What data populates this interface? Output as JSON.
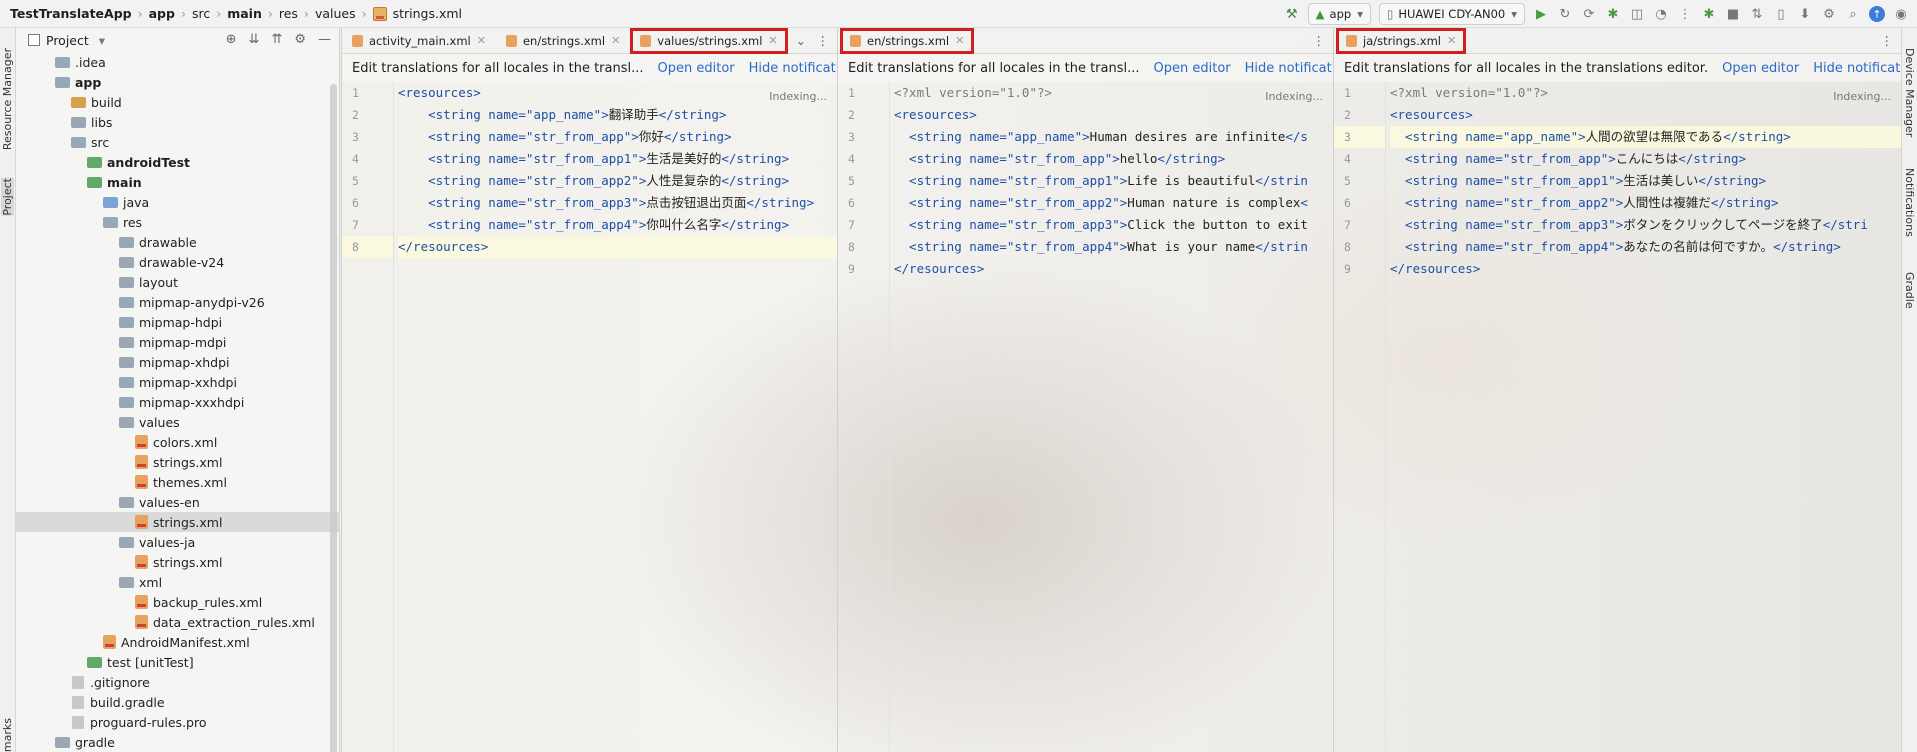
{
  "topbar": {
    "crumbs": [
      "TestTranslateApp",
      "app",
      "src",
      "main",
      "res",
      "values"
    ],
    "file": "strings.xml",
    "run_config": "app",
    "device": "HUAWEI CDY-AN00"
  },
  "strips": {
    "left1": "Resource Manager",
    "left2": "Project",
    "left3": "Bookmarks",
    "right1": "Device Manager",
    "right2": "Notifications",
    "right3": "Gradle"
  },
  "project": {
    "title": "Project",
    "tree": [
      {
        "label": ".idea",
        "arrow": "▶",
        "indent": 1,
        "icon": "folder",
        "bold": false
      },
      {
        "label": "app",
        "arrow": "▼",
        "indent": 1,
        "icon": "folder",
        "bold": true
      },
      {
        "label": "build",
        "arrow": "▶",
        "indent": 2,
        "icon": "orange",
        "bold": false
      },
      {
        "label": "libs",
        "arrow": "",
        "indent": 2,
        "icon": "folder",
        "bold": false
      },
      {
        "label": "src",
        "arrow": "▼",
        "indent": 2,
        "icon": "folder",
        "bold": false
      },
      {
        "label": "androidTest",
        "arrow": "▶",
        "indent": 3,
        "icon": "green",
        "bold": true
      },
      {
        "label": "main",
        "arrow": "▼",
        "indent": 3,
        "icon": "green",
        "bold": true
      },
      {
        "label": "java",
        "arrow": "▶",
        "indent": 4,
        "icon": "src",
        "bold": false
      },
      {
        "label": "res",
        "arrow": "▼",
        "indent": 4,
        "icon": "folder",
        "bold": false
      },
      {
        "label": "drawable",
        "arrow": "▶",
        "indent": 5,
        "icon": "folder",
        "bold": false
      },
      {
        "label": "drawable-v24",
        "arrow": "▶",
        "indent": 5,
        "icon": "folder",
        "bold": false
      },
      {
        "label": "layout",
        "arrow": "▶",
        "indent": 5,
        "icon": "folder",
        "bold": false
      },
      {
        "label": "mipmap-anydpi-v26",
        "arrow": "▶",
        "indent": 5,
        "icon": "folder",
        "bold": false
      },
      {
        "label": "mipmap-hdpi",
        "arrow": "▶",
        "indent": 5,
        "icon": "folder",
        "bold": false
      },
      {
        "label": "mipmap-mdpi",
        "arrow": "▶",
        "indent": 5,
        "icon": "folder",
        "bold": false
      },
      {
        "label": "mipmap-xhdpi",
        "arrow": "▶",
        "indent": 5,
        "icon": "folder",
        "bold": false
      },
      {
        "label": "mipmap-xxhdpi",
        "arrow": "▶",
        "indent": 5,
        "icon": "folder",
        "bold": false
      },
      {
        "label": "mipmap-xxxhdpi",
        "arrow": "▶",
        "indent": 5,
        "icon": "folder",
        "bold": false
      },
      {
        "label": "values",
        "arrow": "▼",
        "indent": 5,
        "icon": "folder",
        "bold": false
      },
      {
        "label": "colors.xml",
        "arrow": "",
        "indent": 6,
        "icon": "xml",
        "bold": false
      },
      {
        "label": "strings.xml",
        "arrow": "",
        "indent": 6,
        "icon": "xml",
        "bold": false
      },
      {
        "label": "themes.xml",
        "arrow": "",
        "indent": 6,
        "icon": "xml",
        "bold": false
      },
      {
        "label": "values-en",
        "arrow": "▼",
        "indent": 5,
        "icon": "folder",
        "bold": false
      },
      {
        "label": "strings.xml",
        "arrow": "",
        "indent": 6,
        "icon": "xml",
        "bold": false,
        "selected": true
      },
      {
        "label": "values-ja",
        "arrow": "▼",
        "indent": 5,
        "icon": "folder",
        "bold": false
      },
      {
        "label": "strings.xml",
        "arrow": "",
        "indent": 6,
        "icon": "xml",
        "bold": false
      },
      {
        "label": "xml",
        "arrow": "▼",
        "indent": 5,
        "icon": "folder",
        "bold": false
      },
      {
        "label": "backup_rules.xml",
        "arrow": "",
        "indent": 6,
        "icon": "xml",
        "bold": false
      },
      {
        "label": "data_extraction_rules.xml",
        "arrow": "",
        "indent": 6,
        "icon": "xml",
        "bold": false
      },
      {
        "label": "AndroidManifest.xml",
        "arrow": "",
        "indent": 4,
        "icon": "xml",
        "bold": false
      },
      {
        "label": "test [unitTest]",
        "arrow": "▶",
        "indent": 3,
        "icon": "green",
        "bold": false,
        "boldpart": "[unitTest]"
      },
      {
        "label": ".gitignore",
        "arrow": "",
        "indent": 2,
        "icon": "file",
        "bold": false
      },
      {
        "label": "build.gradle",
        "arrow": "",
        "indent": 2,
        "icon": "file",
        "bold": false
      },
      {
        "label": "proguard-rules.pro",
        "arrow": "",
        "indent": 2,
        "icon": "file",
        "bold": false
      },
      {
        "label": "gradle",
        "arrow": "▶",
        "indent": 1,
        "icon": "folder",
        "bold": false
      }
    ]
  },
  "notification": {
    "text1": "Edit translations for all locales in the transl...",
    "text3": "Edit translations for all locales in the translations editor.",
    "open": "Open editor",
    "hide": "Hide notification"
  },
  "indexing": "Indexing...",
  "pane1": {
    "tabs": [
      "activity_main.xml",
      "en/strings.xml",
      "values/strings.xml"
    ],
    "lines": [
      [
        "<resources>"
      ],
      [
        "    <string name=\"app_name\">",
        "翻译助手",
        "</string>"
      ],
      [
        "    <string name=\"str_from_app\">",
        "你好",
        "</string>"
      ],
      [
        "    <string name=\"str_from_app1\">",
        "生活是美好的",
        "</string>"
      ],
      [
        "    <string name=\"str_from_app2\">",
        "人性是复杂的",
        "</string>"
      ],
      [
        "    <string name=\"str_from_app3\">",
        "点击按钮退出页面",
        "</string>"
      ],
      [
        "    <string name=\"str_from_app4\">",
        "你叫什么名字",
        "</string>"
      ],
      [
        "</resources>"
      ]
    ]
  },
  "pane2": {
    "tabs": [
      "en/strings.xml"
    ],
    "lines": [
      [
        "<?xml version=\"1.0\"?>"
      ],
      [
        "<resources>"
      ],
      [
        "  <string name=\"app_name\">",
        "Human desires are infinite",
        "</s"
      ],
      [
        "  <string name=\"str_from_app\">",
        "hello",
        "</string>"
      ],
      [
        "  <string name=\"str_from_app1\">",
        "Life is beautiful",
        "</strin"
      ],
      [
        "  <string name=\"str_from_app2\">",
        "Human nature is complex",
        "<"
      ],
      [
        "  <string name=\"str_from_app3\">",
        "Click the button to exit",
        ""
      ],
      [
        "  <string name=\"str_from_app4\">",
        "What is your name",
        "</strin"
      ],
      [
        "</resources>"
      ]
    ]
  },
  "pane3": {
    "tabs": [
      "ja/strings.xml"
    ],
    "lines": [
      [
        "<?xml version=\"1.0\"?>"
      ],
      [
        "<resources>"
      ],
      [
        "  <string name=\"app_name\">",
        "人間の欲望は無限である",
        "</string>"
      ],
      [
        "  <string name=\"str_from_app\">",
        "こんにちは",
        "</string>"
      ],
      [
        "  <string name=\"str_from_app1\">",
        "生活は美しい",
        "</string>"
      ],
      [
        "  <string name=\"str_from_app2\">",
        "人間性は複雑だ",
        "</string>"
      ],
      [
        "  <string name=\"str_from_app3\">",
        "ボタンをクリックしてページを終了",
        "</stri"
      ],
      [
        "  <string name=\"str_from_app4\">",
        "あなたの名前は何ですか。",
        "</string>"
      ],
      [
        "</resources>"
      ]
    ]
  },
  "colors": {
    "highlight": "#d11f1f",
    "link": "#2a6ac8",
    "tag": "#1e4fa7",
    "string": "#1c7c1c"
  }
}
